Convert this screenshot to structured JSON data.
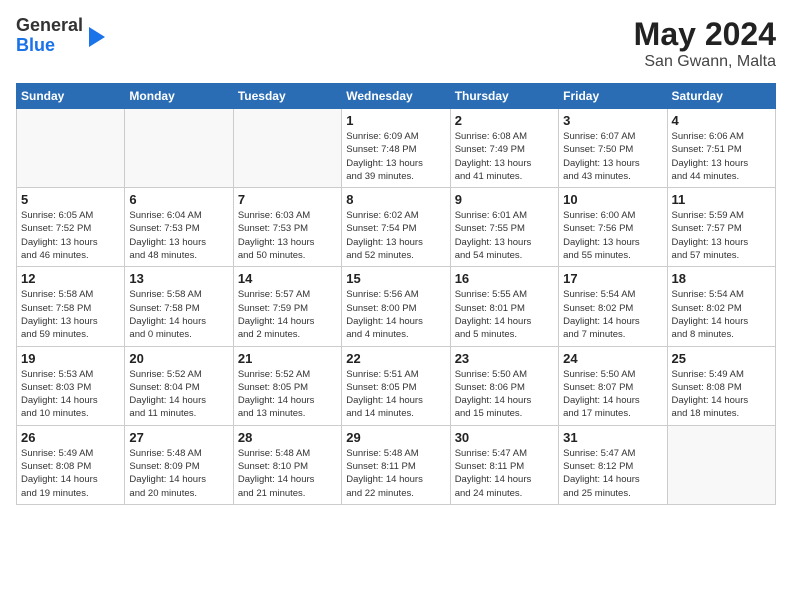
{
  "header": {
    "logo": {
      "general": "General",
      "blue": "Blue"
    },
    "title": "May 2024",
    "location": "San Gwann, Malta"
  },
  "weekdays": [
    "Sunday",
    "Monday",
    "Tuesday",
    "Wednesday",
    "Thursday",
    "Friday",
    "Saturday"
  ],
  "weeks": [
    [
      {
        "day": "",
        "info": ""
      },
      {
        "day": "",
        "info": ""
      },
      {
        "day": "",
        "info": ""
      },
      {
        "day": "1",
        "info": "Sunrise: 6:09 AM\nSunset: 7:48 PM\nDaylight: 13 hours\nand 39 minutes."
      },
      {
        "day": "2",
        "info": "Sunrise: 6:08 AM\nSunset: 7:49 PM\nDaylight: 13 hours\nand 41 minutes."
      },
      {
        "day": "3",
        "info": "Sunrise: 6:07 AM\nSunset: 7:50 PM\nDaylight: 13 hours\nand 43 minutes."
      },
      {
        "day": "4",
        "info": "Sunrise: 6:06 AM\nSunset: 7:51 PM\nDaylight: 13 hours\nand 44 minutes."
      }
    ],
    [
      {
        "day": "5",
        "info": "Sunrise: 6:05 AM\nSunset: 7:52 PM\nDaylight: 13 hours\nand 46 minutes."
      },
      {
        "day": "6",
        "info": "Sunrise: 6:04 AM\nSunset: 7:53 PM\nDaylight: 13 hours\nand 48 minutes."
      },
      {
        "day": "7",
        "info": "Sunrise: 6:03 AM\nSunset: 7:53 PM\nDaylight: 13 hours\nand 50 minutes."
      },
      {
        "day": "8",
        "info": "Sunrise: 6:02 AM\nSunset: 7:54 PM\nDaylight: 13 hours\nand 52 minutes."
      },
      {
        "day": "9",
        "info": "Sunrise: 6:01 AM\nSunset: 7:55 PM\nDaylight: 13 hours\nand 54 minutes."
      },
      {
        "day": "10",
        "info": "Sunrise: 6:00 AM\nSunset: 7:56 PM\nDaylight: 13 hours\nand 55 minutes."
      },
      {
        "day": "11",
        "info": "Sunrise: 5:59 AM\nSunset: 7:57 PM\nDaylight: 13 hours\nand 57 minutes."
      }
    ],
    [
      {
        "day": "12",
        "info": "Sunrise: 5:58 AM\nSunset: 7:58 PM\nDaylight: 13 hours\nand 59 minutes."
      },
      {
        "day": "13",
        "info": "Sunrise: 5:58 AM\nSunset: 7:58 PM\nDaylight: 14 hours\nand 0 minutes."
      },
      {
        "day": "14",
        "info": "Sunrise: 5:57 AM\nSunset: 7:59 PM\nDaylight: 14 hours\nand 2 minutes."
      },
      {
        "day": "15",
        "info": "Sunrise: 5:56 AM\nSunset: 8:00 PM\nDaylight: 14 hours\nand 4 minutes."
      },
      {
        "day": "16",
        "info": "Sunrise: 5:55 AM\nSunset: 8:01 PM\nDaylight: 14 hours\nand 5 minutes."
      },
      {
        "day": "17",
        "info": "Sunrise: 5:54 AM\nSunset: 8:02 PM\nDaylight: 14 hours\nand 7 minutes."
      },
      {
        "day": "18",
        "info": "Sunrise: 5:54 AM\nSunset: 8:02 PM\nDaylight: 14 hours\nand 8 minutes."
      }
    ],
    [
      {
        "day": "19",
        "info": "Sunrise: 5:53 AM\nSunset: 8:03 PM\nDaylight: 14 hours\nand 10 minutes."
      },
      {
        "day": "20",
        "info": "Sunrise: 5:52 AM\nSunset: 8:04 PM\nDaylight: 14 hours\nand 11 minutes."
      },
      {
        "day": "21",
        "info": "Sunrise: 5:52 AM\nSunset: 8:05 PM\nDaylight: 14 hours\nand 13 minutes."
      },
      {
        "day": "22",
        "info": "Sunrise: 5:51 AM\nSunset: 8:05 PM\nDaylight: 14 hours\nand 14 minutes."
      },
      {
        "day": "23",
        "info": "Sunrise: 5:50 AM\nSunset: 8:06 PM\nDaylight: 14 hours\nand 15 minutes."
      },
      {
        "day": "24",
        "info": "Sunrise: 5:50 AM\nSunset: 8:07 PM\nDaylight: 14 hours\nand 17 minutes."
      },
      {
        "day": "25",
        "info": "Sunrise: 5:49 AM\nSunset: 8:08 PM\nDaylight: 14 hours\nand 18 minutes."
      }
    ],
    [
      {
        "day": "26",
        "info": "Sunrise: 5:49 AM\nSunset: 8:08 PM\nDaylight: 14 hours\nand 19 minutes."
      },
      {
        "day": "27",
        "info": "Sunrise: 5:48 AM\nSunset: 8:09 PM\nDaylight: 14 hours\nand 20 minutes."
      },
      {
        "day": "28",
        "info": "Sunrise: 5:48 AM\nSunset: 8:10 PM\nDaylight: 14 hours\nand 21 minutes."
      },
      {
        "day": "29",
        "info": "Sunrise: 5:48 AM\nSunset: 8:11 PM\nDaylight: 14 hours\nand 22 minutes."
      },
      {
        "day": "30",
        "info": "Sunrise: 5:47 AM\nSunset: 8:11 PM\nDaylight: 14 hours\nand 24 minutes."
      },
      {
        "day": "31",
        "info": "Sunrise: 5:47 AM\nSunset: 8:12 PM\nDaylight: 14 hours\nand 25 minutes."
      },
      {
        "day": "",
        "info": ""
      }
    ]
  ]
}
